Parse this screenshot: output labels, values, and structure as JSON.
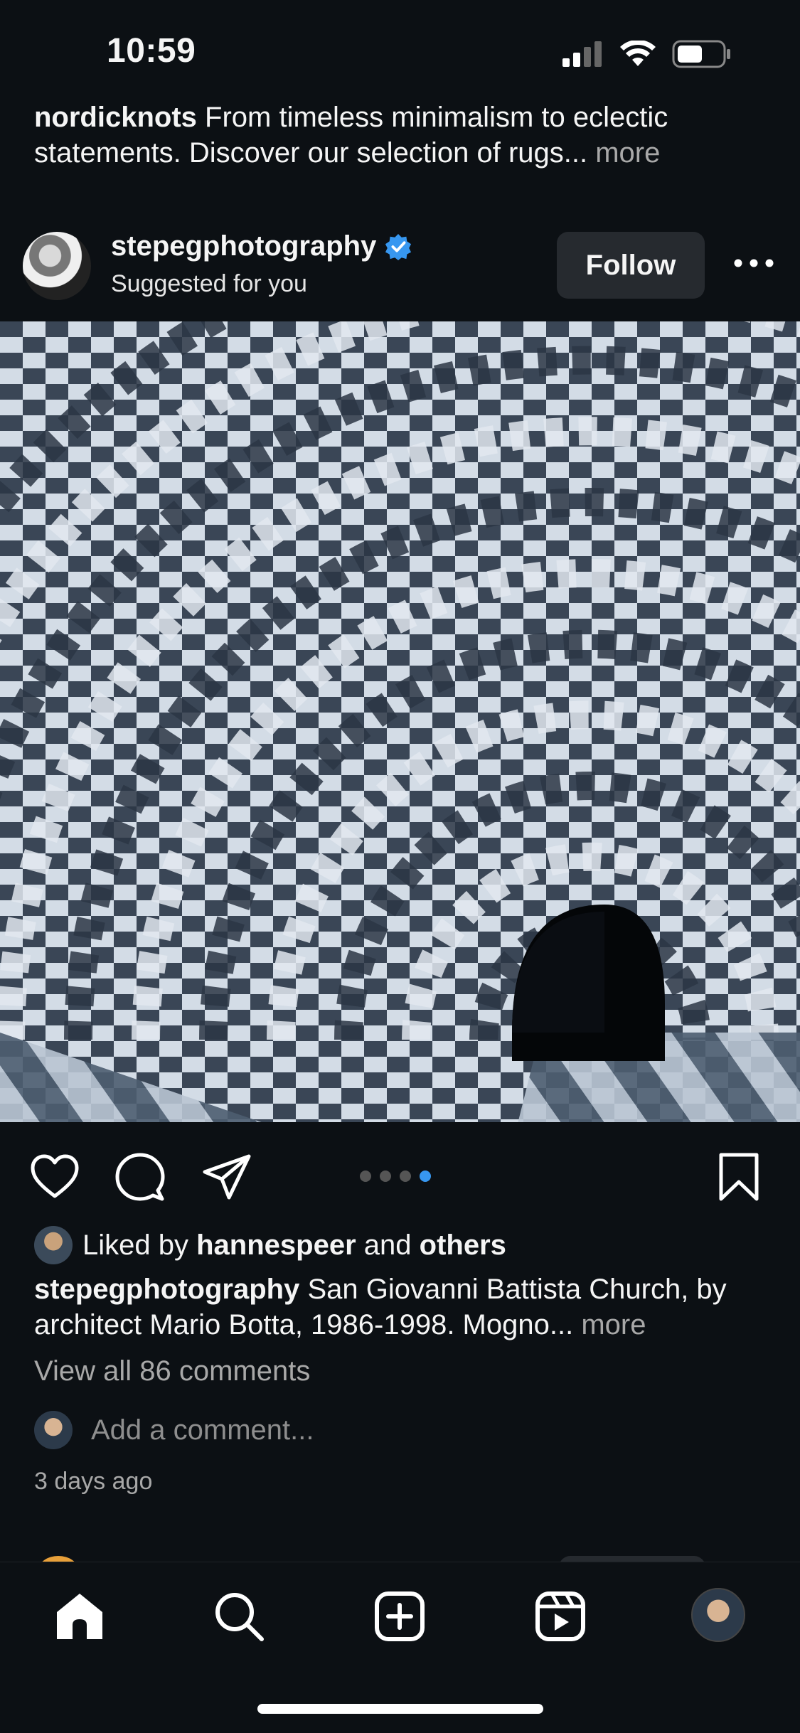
{
  "status_bar": {
    "time": "10:59"
  },
  "previous_post": {
    "username": "nordicknots",
    "caption": "From timeless minimalism to eclectic statements. Discover our selection of rugs...",
    "more_label": "more"
  },
  "post": {
    "username": "stepegphotography",
    "subtitle": "Suggested for you",
    "follow_label": "Follow",
    "carousel": {
      "count": 4,
      "active_index": 3
    },
    "likes": {
      "prefix": "Liked by",
      "user": "hannespeer",
      "and": "and",
      "others": "others"
    },
    "caption_user": "stepegphotography",
    "caption_text": "San Giovanni Battista Church, by architect Mario Botta, 1986-1998. Mogno...",
    "more_label": "more",
    "view_comments": "View all 86 comments",
    "add_comment_placeholder": "Add a comment...",
    "time_ago": "3 days ago"
  },
  "colors": {
    "background": "#0c1014",
    "accent": "#3797f0",
    "verified": "#3797f0"
  },
  "icons": [
    "heart-icon",
    "comment-icon",
    "share-icon",
    "bookmark-icon",
    "home-icon",
    "search-icon",
    "create-icon",
    "reels-icon"
  ]
}
